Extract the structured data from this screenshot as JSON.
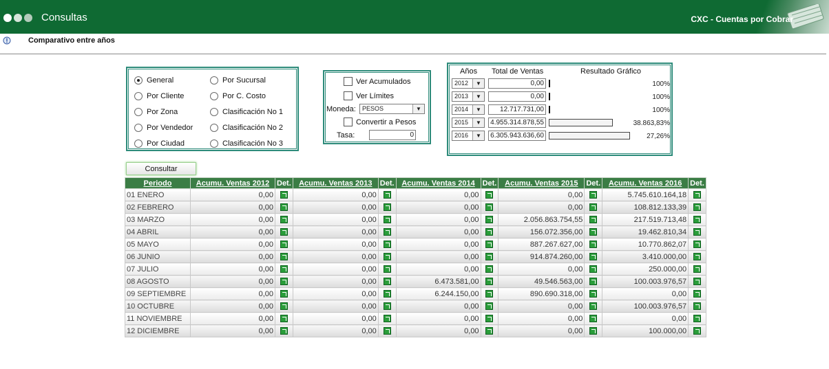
{
  "header": {
    "app_title": "Consultas",
    "module_title": "CXC - Cuentas por Cobrar",
    "brand_color": "#0f6a33"
  },
  "page": {
    "title": "Comparativo entre años"
  },
  "options": {
    "left_column": [
      {
        "label": "General",
        "selected": true
      },
      {
        "label": "Por Cliente",
        "selected": false
      },
      {
        "label": "Por Zona",
        "selected": false
      },
      {
        "label": "Por Vendedor",
        "selected": false
      },
      {
        "label": "Por Ciudad",
        "selected": false
      }
    ],
    "right_column": [
      {
        "label": "Por Sucursal",
        "selected": false
      },
      {
        "label": "Por C. Costo",
        "selected": false
      },
      {
        "label": "Clasificación No 1",
        "selected": false
      },
      {
        "label": "Clasificación No 2",
        "selected": false
      },
      {
        "label": "Clasificación No 3",
        "selected": false
      }
    ]
  },
  "settings": {
    "ver_acumulados": "Ver Acumulados",
    "ver_limites": "Ver Límites",
    "moneda_label": "Moneda:",
    "moneda_value": "PESOS",
    "convertir": "Convertir a Pesos",
    "tasa_label": "Tasa:",
    "tasa_value": "0"
  },
  "summary": {
    "headers": {
      "years": "Años",
      "total": "Total de Ventas",
      "graph": "Resultado Gráfico"
    },
    "rows": [
      {
        "year": "2012",
        "total": "0,00",
        "pct": "100%",
        "bar_fraction": 0
      },
      {
        "year": "2013",
        "total": "0,00",
        "pct": "100%",
        "bar_fraction": 0
      },
      {
        "year": "2014",
        "total": "12.717.731,00",
        "pct": "100%",
        "bar_fraction": 0
      },
      {
        "year": "2015",
        "total": "4.955.314.878,55",
        "pct": "38.863,83%",
        "bar_fraction": 0.786
      },
      {
        "year": "2016",
        "total": "6.305.943.636,60",
        "pct": "27,26%",
        "bar_fraction": 1.0
      }
    ]
  },
  "consult_button": "Consultar",
  "table": {
    "headers": [
      "Periodo",
      "Acumu. Ventas 2012",
      "Det.",
      "Acumu. Ventas 2013",
      "Det.",
      "Acumu. Ventas 2014",
      "Det.",
      "Acumu. Ventas 2015",
      "Det.",
      "Acumu. Ventas 2016",
      "Det."
    ],
    "rows": [
      {
        "periodo": "01 ENERO",
        "v2012": "0,00",
        "v2013": "0,00",
        "v2014": "0,00",
        "v2015": "0,00",
        "v2016": "5.745.610.164,18"
      },
      {
        "periodo": "02 FEBRERO",
        "v2012": "0,00",
        "v2013": "0,00",
        "v2014": "0,00",
        "v2015": "0,00",
        "v2016": "108.812.133,39"
      },
      {
        "periodo": "03 MARZO",
        "v2012": "0,00",
        "v2013": "0,00",
        "v2014": "0,00",
        "v2015": "2.056.863.754,55",
        "v2016": "217.519.713,48"
      },
      {
        "periodo": "04 ABRIL",
        "v2012": "0,00",
        "v2013": "0,00",
        "v2014": "0,00",
        "v2015": "156.072.356,00",
        "v2016": "19.462.810,34"
      },
      {
        "periodo": "05 MAYO",
        "v2012": "0,00",
        "v2013": "0,00",
        "v2014": "0,00",
        "v2015": "887.267.627,00",
        "v2016": "10.770.862,07"
      },
      {
        "periodo": "06 JUNIO",
        "v2012": "0,00",
        "v2013": "0,00",
        "v2014": "0,00",
        "v2015": "914.874.260,00",
        "v2016": "3.410.000,00"
      },
      {
        "periodo": "07 JULIO",
        "v2012": "0,00",
        "v2013": "0,00",
        "v2014": "0,00",
        "v2015": "0,00",
        "v2016": "250.000,00"
      },
      {
        "periodo": "08 AGOSTO",
        "v2012": "0,00",
        "v2013": "0,00",
        "v2014": "6.473.581,00",
        "v2015": "49.546.563,00",
        "v2016": "100.003.976,57"
      },
      {
        "periodo": "09 SEPTIEMBRE",
        "v2012": "0,00",
        "v2013": "0,00",
        "v2014": "6.244.150,00",
        "v2015": "890.690.318,00",
        "v2016": "0,00"
      },
      {
        "periodo": "10 OCTUBRE",
        "v2012": "0,00",
        "v2013": "0,00",
        "v2014": "0,00",
        "v2015": "0,00",
        "v2016": "100.003.976,57"
      },
      {
        "periodo": "11 NOVIEMBRE",
        "v2012": "0,00",
        "v2013": "0,00",
        "v2014": "0,00",
        "v2015": "0,00",
        "v2016": "0,00"
      },
      {
        "periodo": "12 DICIEMBRE",
        "v2012": "0,00",
        "v2013": "0,00",
        "v2014": "0,00",
        "v2015": "0,00",
        "v2016": "100.000,00"
      }
    ]
  }
}
